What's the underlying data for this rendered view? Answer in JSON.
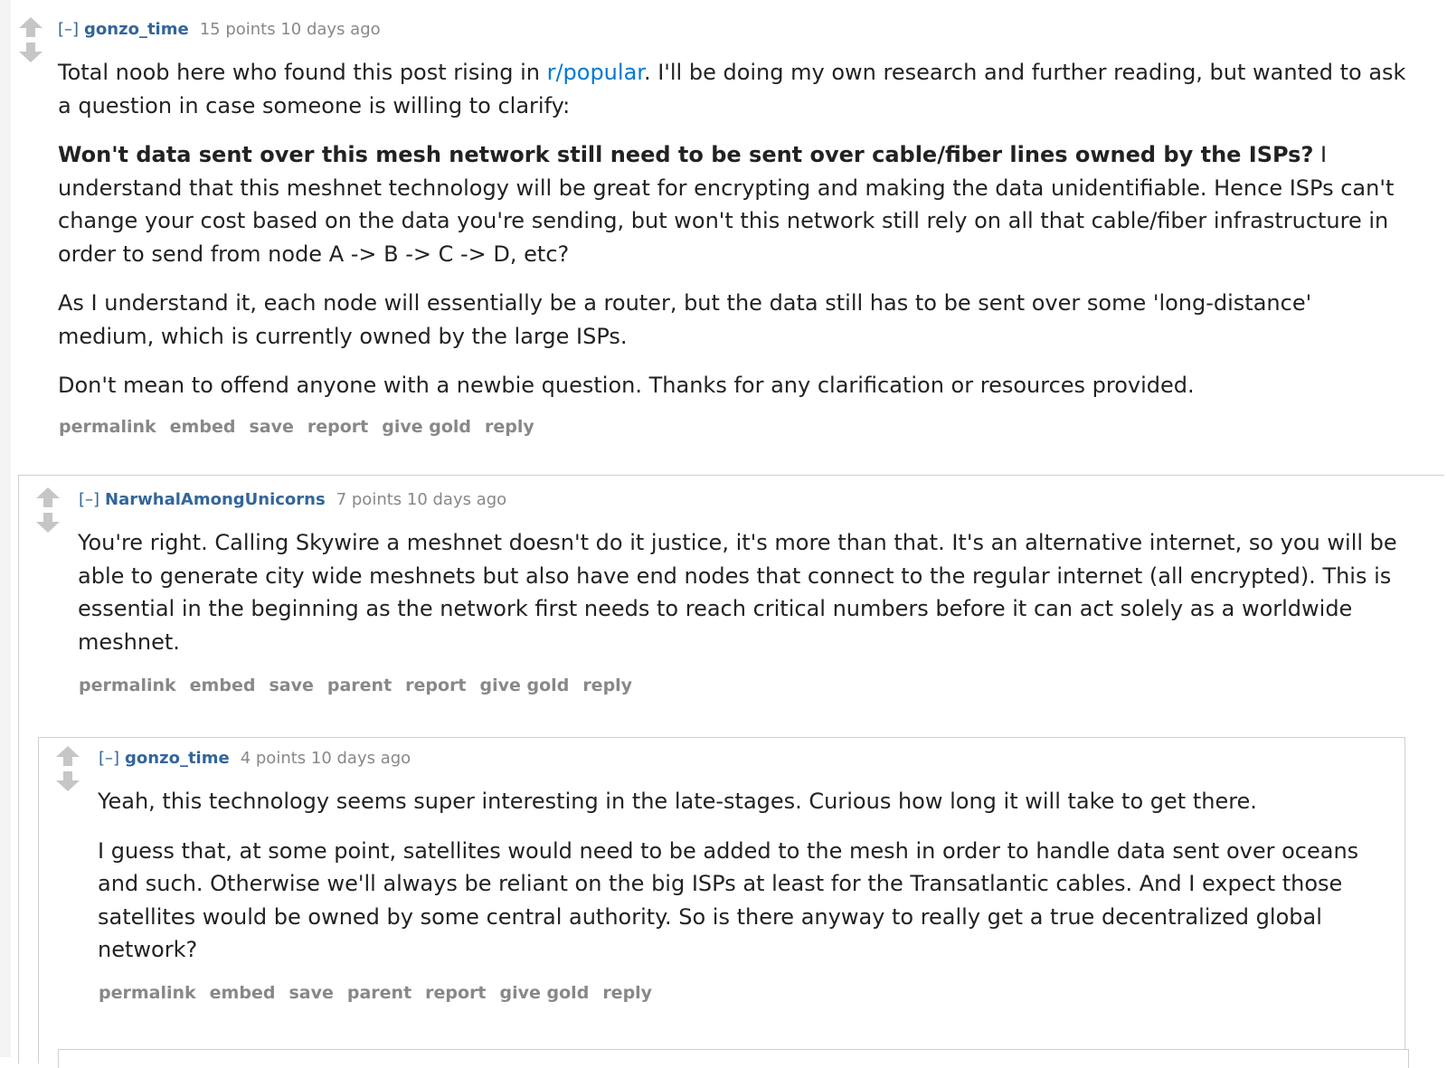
{
  "comments": [
    {
      "collapse": "[–]",
      "author": "gonzo_time",
      "meta": "15 points 10 days ago",
      "p1_pre": "Total noob here who found this post rising in ",
      "p1_link": "r/popular",
      "p1_post": ". I'll be doing my own research and further reading, but wanted to ask a question in case someone is willing to clarify:",
      "p2_bold": "Won't data sent over this mesh network still need to be sent over cable/fiber lines owned by the ISPs?",
      "p2_rest": " I understand that this meshnet technology will be great for encrypting and making the data unidentifiable. Hence ISPs can't change your cost based on the data you're sending, but won't this network still rely on all that cable/fiber infrastructure in order to send from node A -> B -> C -> D, etc?",
      "p3": "As I understand it, each node will essentially be a router, but the data still has to be sent over some 'long-distance' medium, which is currently owned by the large ISPs.",
      "p4": "Don't mean to offend anyone with a newbie question. Thanks for any clarification or resources provided.",
      "buttons": [
        "permalink",
        "embed",
        "save",
        "report",
        "give gold",
        "reply"
      ]
    },
    {
      "collapse": "[–]",
      "author": "NarwhalAmongUnicorns",
      "meta": "7 points 10 days ago",
      "p1": "You're right. Calling Skywire a meshnet doesn't do it justice, it's more than that. It's an alternative internet, so you will be able to generate city wide meshnets but also have end nodes that connect to the regular internet (all encrypted). This is essential in the beginning as the network first needs to reach critical numbers before it can act solely as a worldwide meshnet.",
      "buttons": [
        "permalink",
        "embed",
        "save",
        "parent",
        "report",
        "give gold",
        "reply"
      ]
    },
    {
      "collapse": "[–]",
      "author": "gonzo_time",
      "meta": "4 points 10 days ago",
      "p1": "Yeah, this technology seems super interesting in the late-stages. Curious how long it will take to get there.",
      "p2": "I guess that, at some point, satellites would need to be added to the mesh in order to handle data sent over oceans and such. Otherwise we'll always be reliant on the big ISPs at least for the Transatlantic cables. And I expect those satellites would be owned by some central authority. So is there anyway to really get a true decentralized global network?",
      "buttons": [
        "permalink",
        "embed",
        "save",
        "parent",
        "report",
        "give gold",
        "reply"
      ]
    }
  ],
  "colors": {
    "link": "#0079d3",
    "author": "#336699",
    "muted": "#888888",
    "border": "#cfcfcf"
  }
}
